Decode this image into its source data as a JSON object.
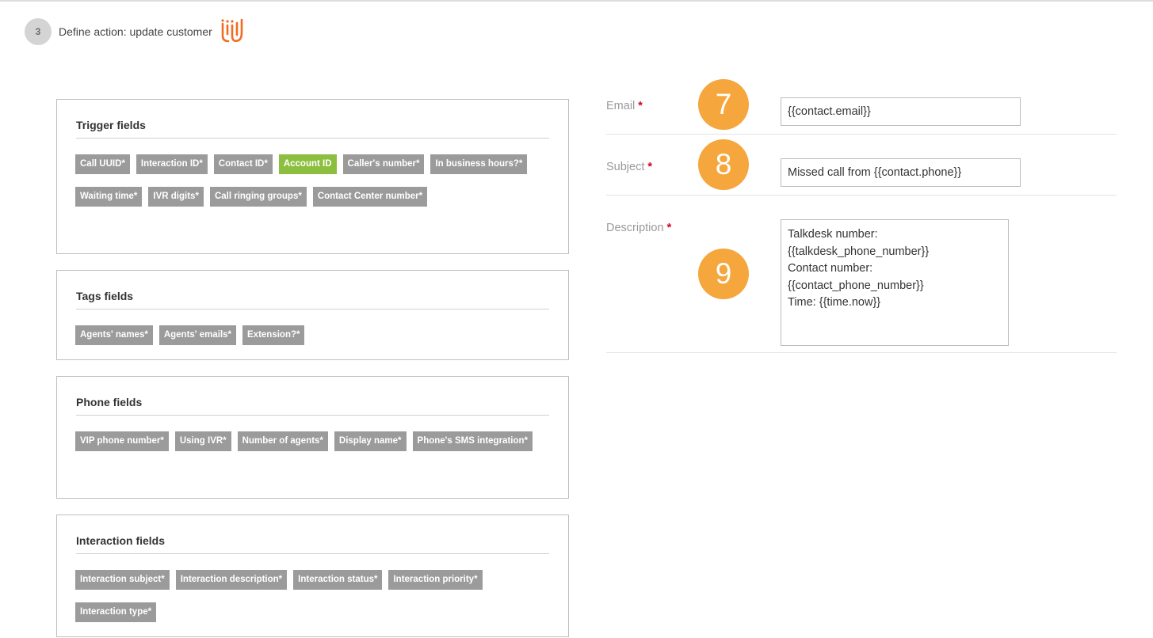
{
  "step": {
    "number": "3",
    "title": "Define action: update customer",
    "logo_icon": "integration-logo-icon"
  },
  "panels": {
    "trigger": {
      "title": "Trigger fields",
      "chips": [
        "Call UUID*",
        "Interaction ID*",
        "Contact ID*",
        "Account ID",
        "Caller's number*",
        "In business hours?*",
        "Waiting time*",
        "IVR digits*",
        "Call ringing groups*",
        "Contact Center number*"
      ]
    },
    "tags": {
      "title": "Tags fields",
      "chips": [
        "Agents' names*",
        "Agents' emails*",
        "Extension?*"
      ]
    },
    "phone": {
      "title": "Phone fields",
      "chips": [
        "VIP phone number*",
        "Using IVR*",
        "Number of agents*",
        "Display name*",
        "Phone's SMS integration*"
      ]
    },
    "interaction": {
      "title": "Interaction fields",
      "chips": [
        "Interaction subject*",
        "Interaction description*",
        "Interaction status*",
        "Interaction priority*",
        "Interaction type*"
      ]
    }
  },
  "form": {
    "email": {
      "label": "Email",
      "required": "*",
      "badge": "7",
      "value": "{{contact.email}}"
    },
    "subject": {
      "label": "Subject",
      "required": "*",
      "badge": "8",
      "value": "Missed call from {{contact.phone}}"
    },
    "description": {
      "label": "Description",
      "required": "*",
      "badge": "9",
      "lines": [
        "Talkdesk number:",
        "{{talkdesk_phone_number}}",
        "Contact number:",
        "{{contact_phone_number}}",
        "Time: {{time.now}}"
      ]
    }
  },
  "colors": {
    "chip_default": "#9b9b9b",
    "chip_highlight": "#8cbf3f",
    "badge": "#f5a63c",
    "required": "#d0021b",
    "logo": "#f26b21"
  }
}
